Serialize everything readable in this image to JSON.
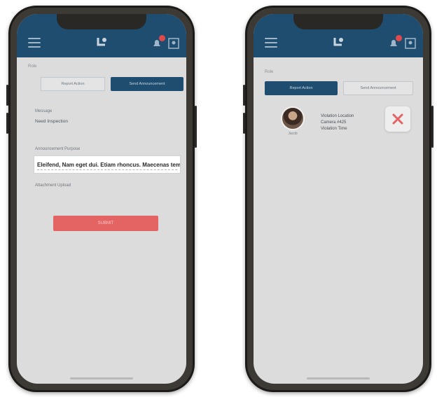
{
  "colors": {
    "header": "#1e4d70",
    "screen_bg": "#dcdcdc",
    "danger": "#e46463",
    "badge": "#e04a4a"
  },
  "left_screen": {
    "section_label": "Role",
    "tabs": [
      {
        "label": "Report Action",
        "active": false
      },
      {
        "label": "Send Announcement",
        "active": true
      }
    ],
    "message_label": "Message",
    "message_value": "Need Inspection",
    "description_label": "Announcement Purpose",
    "description_value": "Eleifend, Nam eget dui. Etiam rhoncus. Maecenas tempus",
    "attach_label": "Attachment Upload",
    "submit_label": "SUBMIT"
  },
  "right_screen": {
    "section_label": "Role",
    "tabs": [
      {
        "label": "Report Action",
        "active": true
      },
      {
        "label": "Send Announcement",
        "active": false
      }
    ],
    "profile_name": "Jacob",
    "info_lines": [
      "Violation Location",
      "Camera #425",
      "Violation Time"
    ],
    "reject_label": "X"
  },
  "icons": {
    "menu": "hamburger-menu-icon",
    "logo": "app-logo-icon",
    "notification": "bell-icon",
    "profile": "user-icon",
    "reject": "close-x-icon"
  }
}
